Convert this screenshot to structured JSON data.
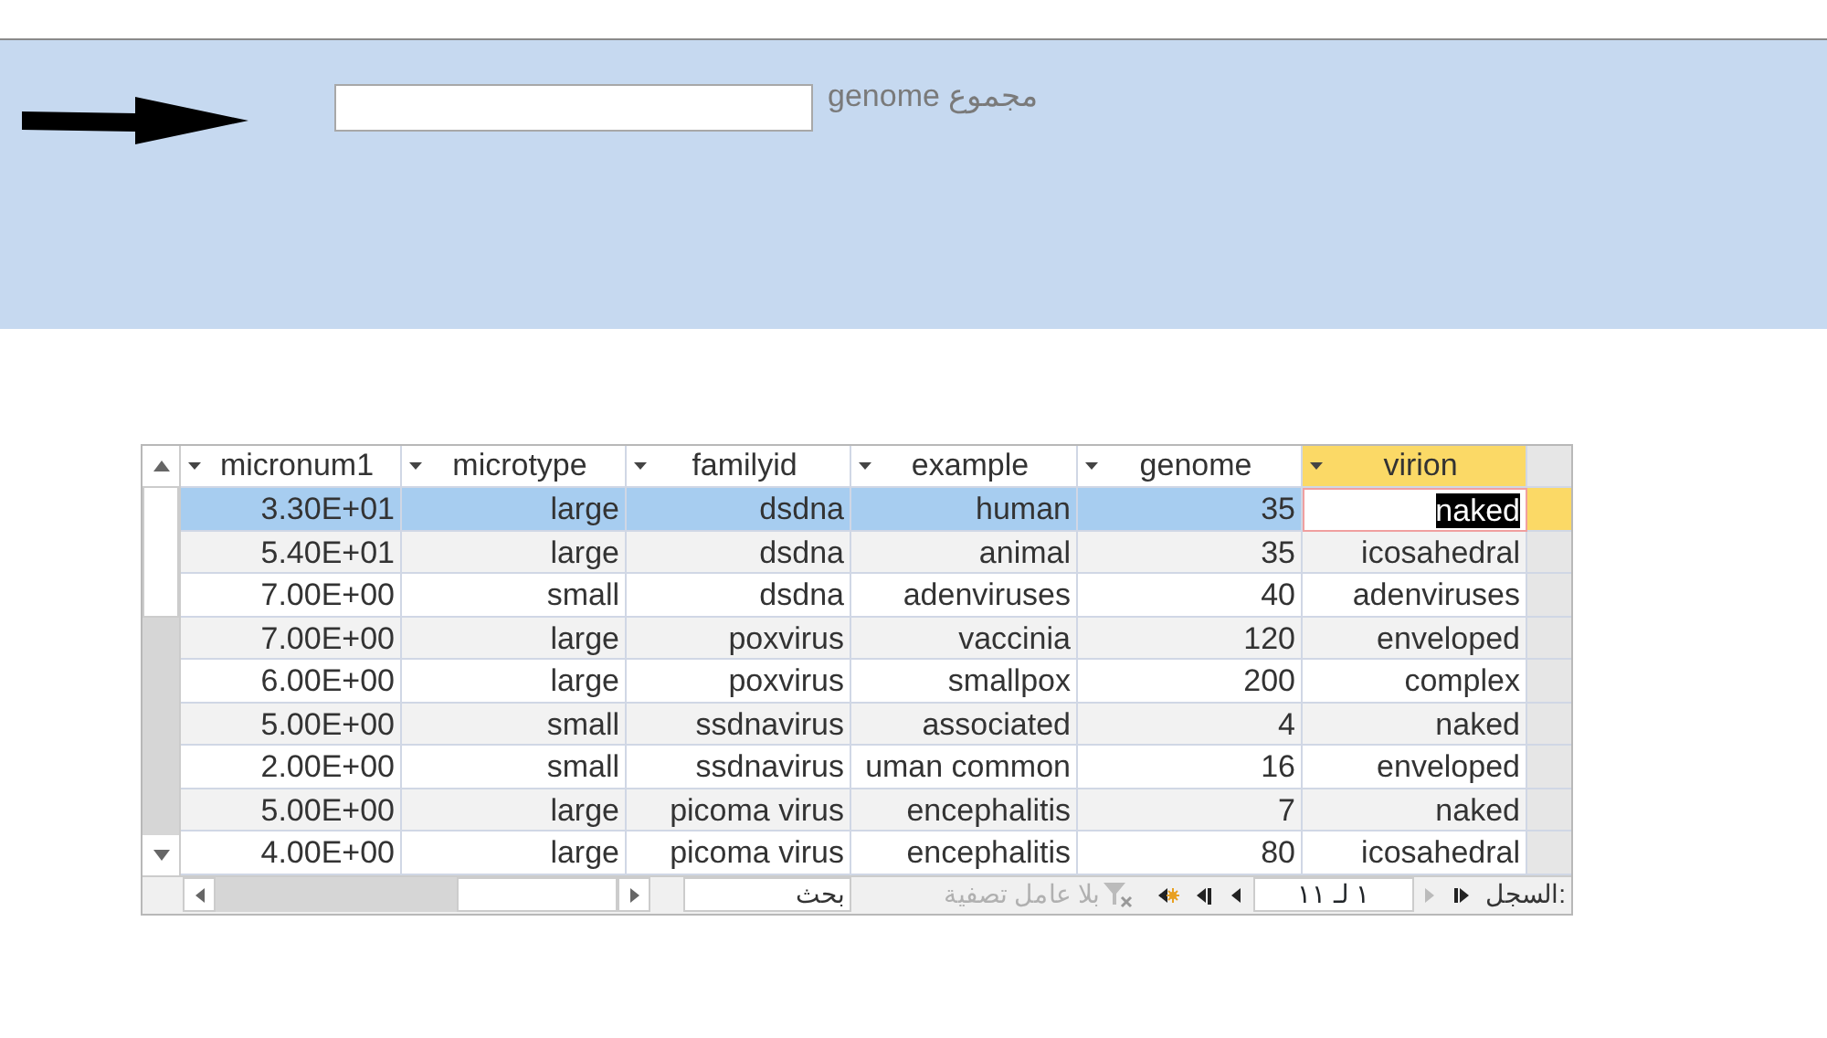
{
  "form": {
    "total_label": "مجموع genome"
  },
  "table": {
    "columns": [
      {
        "label": "micronum1",
        "selected": false
      },
      {
        "label": "microtype",
        "selected": false
      },
      {
        "label": "familyid",
        "selected": false
      },
      {
        "label": "example",
        "selected": false
      },
      {
        "label": "genome",
        "selected": false
      },
      {
        "label": "virion",
        "selected": true
      }
    ],
    "rows": [
      {
        "selected": true,
        "cells": [
          "3.30E+01",
          "large",
          "dsdna",
          "human",
          "35",
          "naked"
        ]
      },
      {
        "selected": false,
        "cells": [
          "5.40E+01",
          "large",
          "dsdna",
          "animal",
          "35",
          "icosahedral"
        ]
      },
      {
        "selected": false,
        "cells": [
          "7.00E+00",
          "small",
          "dsdna",
          "adenviruses",
          "40",
          "adenviruses"
        ]
      },
      {
        "selected": false,
        "cells": [
          "7.00E+00",
          "large",
          "poxvirus",
          "vaccinia",
          "120",
          "enveloped"
        ]
      },
      {
        "selected": false,
        "cells": [
          "6.00E+00",
          "large",
          "poxvirus",
          "smallpox",
          "200",
          "complex"
        ]
      },
      {
        "selected": false,
        "cells": [
          "5.00E+00",
          "small",
          "ssdnavirus",
          "associated",
          "4",
          "naked"
        ]
      },
      {
        "selected": false,
        "cells": [
          "2.00E+00",
          "small",
          "ssdnavirus",
          "uman common",
          "16",
          "enveloped"
        ]
      },
      {
        "selected": false,
        "cells": [
          "5.00E+00",
          "large",
          "picoma virus",
          "encephalitis",
          "7",
          "naked"
        ]
      },
      {
        "selected": false,
        "cells": [
          "4.00E+00",
          "large",
          "picoma virus",
          "encephalitis",
          "80",
          "icosahedral"
        ]
      }
    ]
  },
  "navigation": {
    "label": "السجل:",
    "record": "١ لـ ١١",
    "buttons": [
      {
        "kind": "first",
        "disabled": false
      },
      {
        "kind": "prev",
        "disabled": true
      },
      {
        "kind": "next",
        "disabled": false
      },
      {
        "kind": "last",
        "disabled": false
      },
      {
        "kind": "new",
        "disabled": false
      }
    ],
    "filter": {
      "label": "بلا عامل تصفية",
      "disabled": true
    },
    "search": {
      "placeholder": "بحث"
    }
  }
}
